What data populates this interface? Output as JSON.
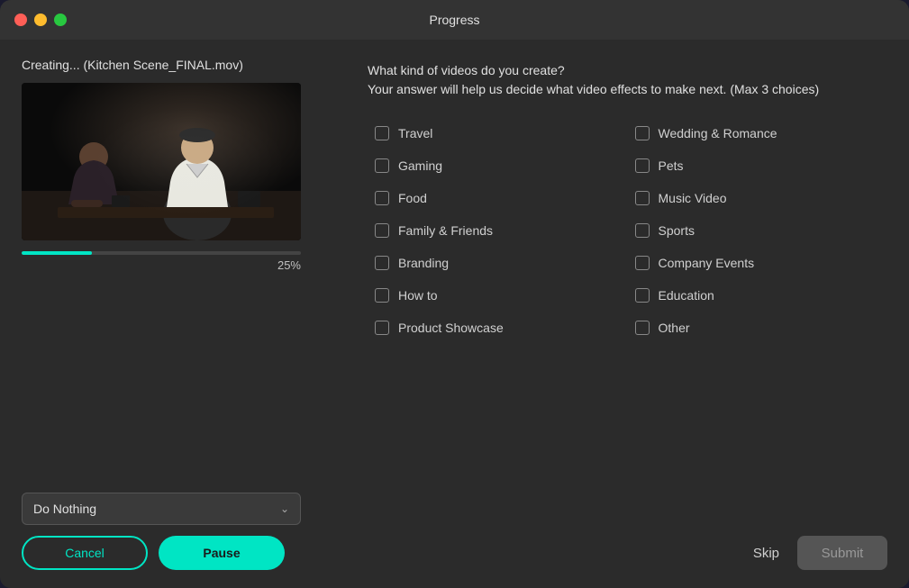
{
  "window": {
    "title": "Progress"
  },
  "left_panel": {
    "creating_label": "Creating... (Kitchen Scene_FINAL.mov)",
    "progress_percentage": "25%",
    "dropdown_label": "Do Nothing",
    "cancel_button": "Cancel",
    "pause_button": "Pause"
  },
  "right_panel": {
    "question_line1": "What kind of videos do you create?",
    "question_line2": "Your answer will help us decide what video effects to make next.  (Max 3 choices)",
    "checkboxes_col1": [
      {
        "id": "travel",
        "label": "Travel",
        "checked": false
      },
      {
        "id": "gaming",
        "label": "Gaming",
        "checked": false
      },
      {
        "id": "food",
        "label": "Food",
        "checked": false
      },
      {
        "id": "family",
        "label": "Family & Friends",
        "checked": false
      },
      {
        "id": "branding",
        "label": "Branding",
        "checked": false
      },
      {
        "id": "howto",
        "label": "How to",
        "checked": false
      },
      {
        "id": "product",
        "label": "Product Showcase",
        "checked": false
      }
    ],
    "checkboxes_col2": [
      {
        "id": "wedding",
        "label": "Wedding & Romance",
        "checked": false
      },
      {
        "id": "pets",
        "label": "Pets",
        "checked": false
      },
      {
        "id": "music",
        "label": "Music Video",
        "checked": false
      },
      {
        "id": "sports",
        "label": "Sports",
        "checked": false
      },
      {
        "id": "company",
        "label": "Company Events",
        "checked": false
      },
      {
        "id": "education",
        "label": "Education",
        "checked": false
      },
      {
        "id": "other",
        "label": "Other",
        "checked": false
      }
    ],
    "skip_button": "Skip",
    "submit_button": "Submit"
  },
  "colors": {
    "accent": "#00e5c4",
    "background": "#2b2b2b",
    "text_primary": "#e0e0e0",
    "text_secondary": "#d0d0d0",
    "disabled": "#555"
  }
}
